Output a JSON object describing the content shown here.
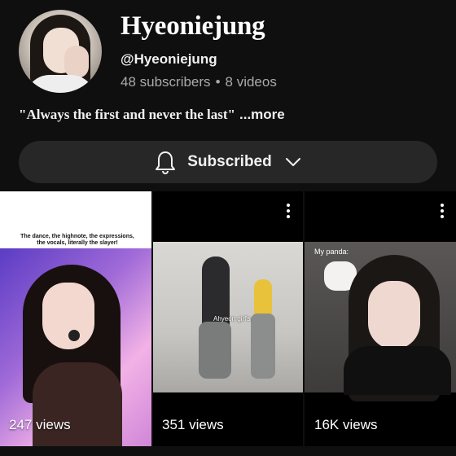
{
  "channel": {
    "name": "Hyeoniejung",
    "handle": "@Hyeoniejung",
    "subscribers": "48 subscribers",
    "separator": "•",
    "videos": "8 videos",
    "description": "\"Always the first and never the last\"",
    "more_label": "...more"
  },
  "subscribe_button": {
    "label": "Subscribed",
    "icon": "bell-icon",
    "dropdown_icon": "chevron-down-icon"
  },
  "videos": [
    {
      "views": "247 views",
      "caption": "The dance, the highnote, the expressions, the vocals, literally the slayer!"
    },
    {
      "views": "351 views",
      "caption": "Ahyeon girl's"
    },
    {
      "views": "16K views",
      "caption": "My panda:"
    }
  ],
  "colors": {
    "background": "#0f0f0f",
    "button_background": "#272727",
    "secondary_text": "#aaaaaa"
  }
}
